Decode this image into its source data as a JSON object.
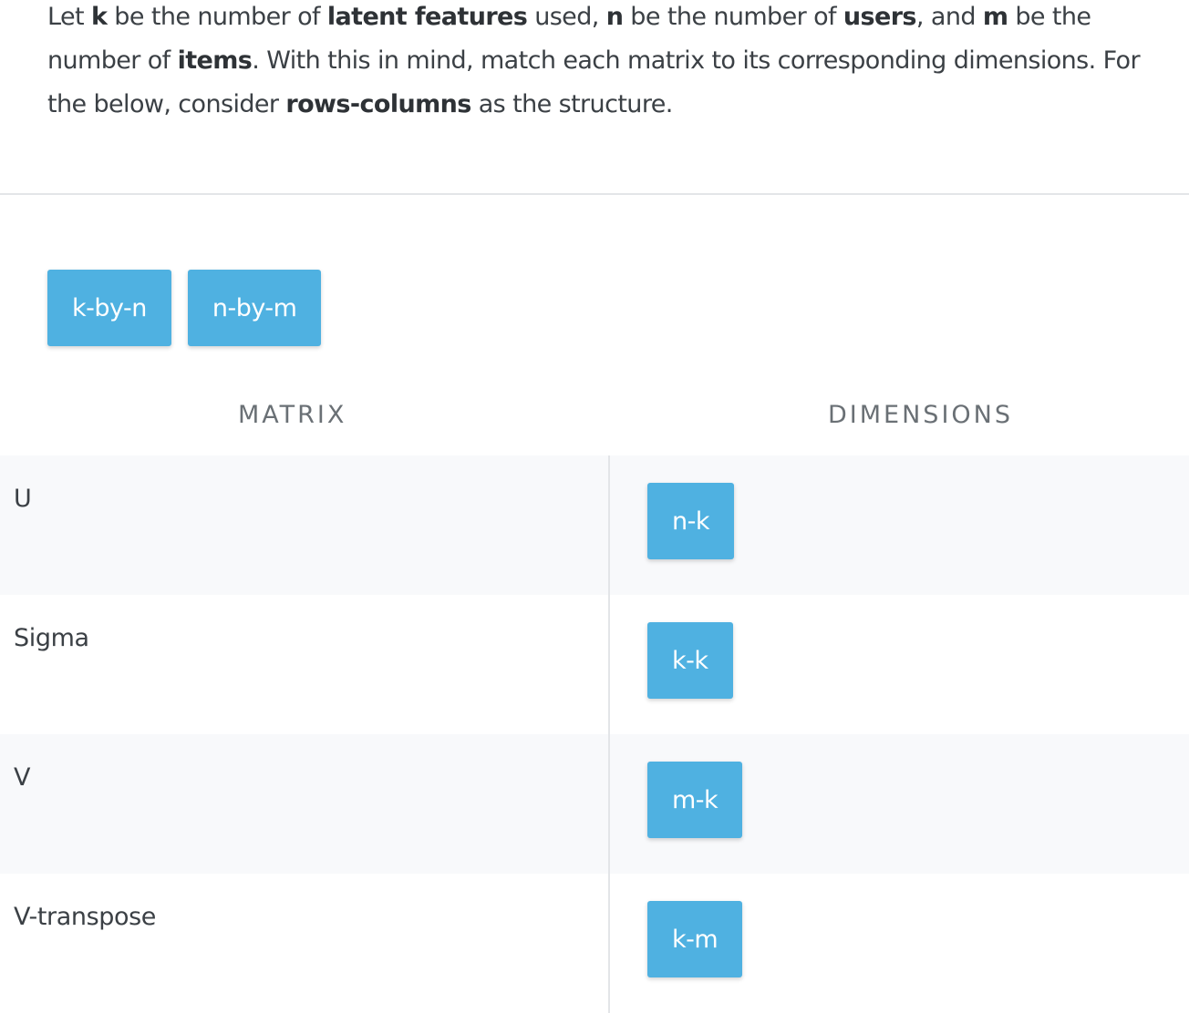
{
  "prompt": {
    "t1": "Let ",
    "b1": "k",
    "t2": " be the number of ",
    "b2": "latent features",
    "t3": " used, ",
    "b3": "n",
    "t4": " be the number of ",
    "b4": "users",
    "t5": ", and ",
    "b5": "m",
    "t6": " be the number of ",
    "b6": "items",
    "t7": ". With this in mind, match each matrix to its corresponding dimensions. For the below, consider ",
    "b7": "rows-columns",
    "t8": " as the structure."
  },
  "bank": {
    "chips": [
      "k-by-n",
      "n-by-m"
    ]
  },
  "headers": {
    "matrix": "MATRIX",
    "dimensions": "DIMENSIONS"
  },
  "rows": [
    {
      "label": "U",
      "answer": "n-k"
    },
    {
      "label": "Sigma",
      "answer": "k-k"
    },
    {
      "label": "V",
      "answer": "m-k"
    },
    {
      "label": "V-transpose",
      "answer": "k-m"
    }
  ],
  "colors": {
    "chip": "#4fb1e1",
    "row_shade": "#f8f9fb",
    "divider": "#e3e5e8"
  }
}
